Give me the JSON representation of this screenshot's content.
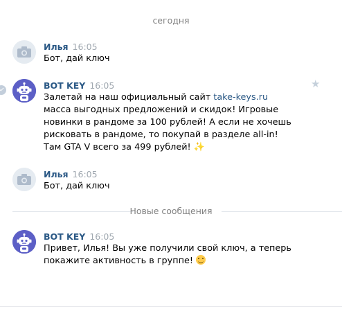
{
  "date_separator": "сегодня",
  "new_messages_separator": "Новые сообщения",
  "messages": [
    {
      "author": "Илья",
      "time": "16:05",
      "avatar": "camera-icon",
      "text": "Бот, дай ключ"
    },
    {
      "author": "BOT KEY",
      "time": "16:05",
      "avatar": "robot-icon",
      "text_before_link": "Залетай на наш официальный сайт ",
      "link": "take-keys.ru",
      "text_after_link": " масса выгодных предложений и скидок! Игровые новинки в рандоме за 100 рублей! А если не хочешь рисковать в рандоме, то покупай в разделе all-in! Там GTA V всего за 499 рублей!",
      "emoji": "✨"
    },
    {
      "author": "Илья",
      "time": "16:05",
      "avatar": "camera-icon",
      "text": "Бот, дай ключ"
    },
    {
      "author": "BOT KEY",
      "time": "16:05",
      "avatar": "robot-icon",
      "text": "Привет, Илья! Вы уже получили свой ключ, а теперь покажите активность в группе!",
      "emoji": "smiling-face"
    }
  ],
  "colors": {
    "author": "#2a5885",
    "time": "#a0a8b0",
    "link": "#2a5885",
    "bot_avatar": "#5c5fc6",
    "user_avatar": "#e5ebf1",
    "separator_text": "#828282"
  }
}
